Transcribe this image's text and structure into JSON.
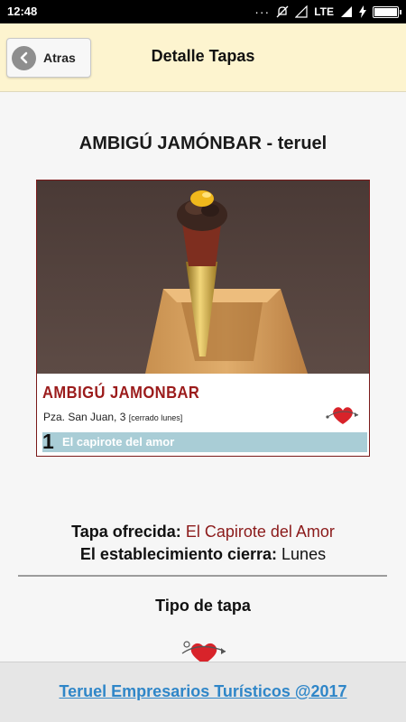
{
  "status_bar": {
    "time": "12:48",
    "network": "LTE",
    "battery_level": 1.0
  },
  "header": {
    "back_label": "Atras",
    "title": "Detalle Tapas"
  },
  "bar": {
    "title": "AMBIGÚ JAMÓNBAR - teruel"
  },
  "tapa_card": {
    "name": "AMBIGÚ JAMONBAR",
    "address": "Pza. San Juan, 3",
    "closed_note": "[cerrado lunes]",
    "number": "1",
    "tapa_name": "El capirote del amor"
  },
  "details": {
    "tapa_label": "Tapa ofrecida:",
    "tapa_value": "El Capirote del Amor",
    "closes_label": "El establecimiento cierra:",
    "closes_value": "Lunes"
  },
  "tipo": {
    "heading": "Tipo de tapa",
    "icon": "heart-arrow-icon"
  },
  "footer": {
    "link": "Teruel Empresarios Turísticos @2017"
  },
  "colors": {
    "header_bg": "#fdf4cf",
    "accent_red": "#8b1a1a",
    "link_blue": "#2f86c8",
    "band_blue": "#a9cdd6"
  }
}
